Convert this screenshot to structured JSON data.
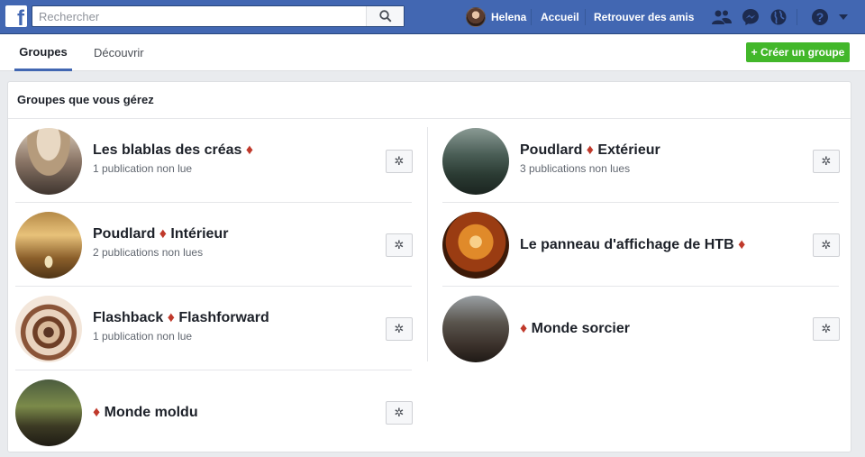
{
  "topbar": {
    "logo": "f",
    "search_placeholder": "Rechercher",
    "user_name": "Helena",
    "home": "Accueil",
    "find_friends": "Retrouver des amis",
    "icons": [
      "friends-icon",
      "messenger-icon",
      "globe-icon",
      "help-icon",
      "caret-down-icon"
    ]
  },
  "tabs": {
    "groups": "Groupes",
    "discover": "Découvrir"
  },
  "create_group": "+ Créer un groupe",
  "managed": {
    "title": "Groupes que vous gérez",
    "gear": "✲",
    "left": [
      {
        "name": "Les blablas des créas ♦",
        "meta": "1 publication non lue"
      },
      {
        "name": "Poudlard ♦ Intérieur",
        "meta": "2 publications non lues"
      },
      {
        "name": "Flashback ♦ Flashforward",
        "meta": "1 publication non lue"
      },
      {
        "name": "♦ Monde moldu",
        "meta": ""
      }
    ],
    "right": [
      {
        "name": "Poudlard ♦ Extérieur",
        "meta": "3 publications non lues"
      },
      {
        "name": "Le panneau d'affichage de HTB ♦",
        "meta": ""
      },
      {
        "name": "♦ Monde sorcier",
        "meta": ""
      }
    ]
  },
  "colors": {
    "brand": "#4267b2",
    "create": "#42b72a",
    "diamond": "#c0392b"
  }
}
